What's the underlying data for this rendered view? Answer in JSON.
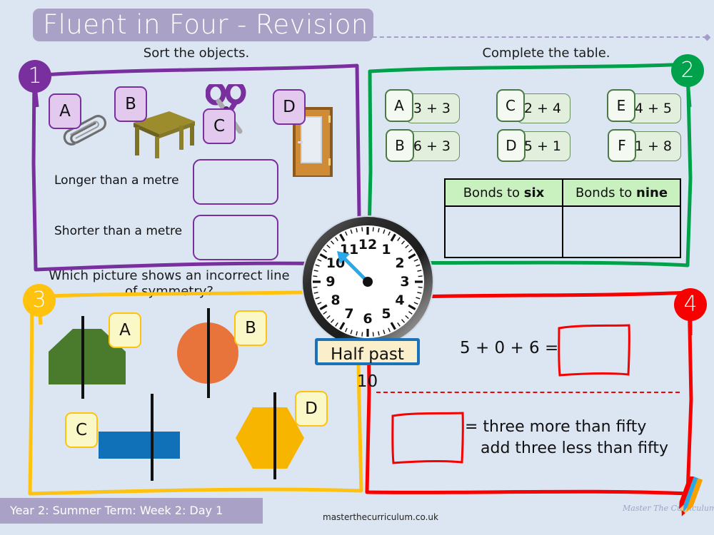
{
  "header": {
    "title": "Fluent in Four - Revision"
  },
  "sections": [
    {
      "number": "1",
      "color": "#7a2f9e",
      "prompt": "Sort the objects.",
      "objects": [
        {
          "label": "A",
          "icon": "paperclip-icon"
        },
        {
          "label": "B",
          "icon": "table-icon"
        },
        {
          "label": "C",
          "icon": "scissors-icon"
        },
        {
          "label": "D",
          "icon": "door-icon"
        }
      ],
      "rows": [
        {
          "label": "Longer than a metre",
          "answer": ""
        },
        {
          "label": "Shorter than a metre",
          "answer": ""
        }
      ]
    },
    {
      "number": "2",
      "color": "#00a14b",
      "prompt": "Complete the table.",
      "sums": [
        {
          "label": "A",
          "expr": "3 + 3"
        },
        {
          "label": "B",
          "expr": "6 + 3"
        },
        {
          "label": "C",
          "expr": "2 + 4"
        },
        {
          "label": "D",
          "expr": "5 + 1"
        },
        {
          "label": "E",
          "expr": "4 + 5"
        },
        {
          "label": "F",
          "expr": "1 + 8"
        }
      ],
      "table": {
        "headers": [
          "Bonds to six",
          "Bonds to nine"
        ],
        "header_plain": [
          "Bonds to ",
          "Bonds to "
        ],
        "header_bold": [
          "six",
          "nine"
        ],
        "rows": [
          [
            "",
            ""
          ]
        ]
      }
    },
    {
      "number": "3",
      "color": "#ffc20e",
      "prompt": "Which picture shows an incorrect line of symmetry?",
      "shapes": [
        {
          "label": "A",
          "shape": "pentagon-house-icon",
          "color": "#4a7a2b"
        },
        {
          "label": "B",
          "shape": "circle-icon",
          "color": "#e8743b"
        },
        {
          "label": "C",
          "shape": "rectangle-icon",
          "color": "#1071b8"
        },
        {
          "label": "D",
          "shape": "hexagon-icon",
          "color": "#f7b500"
        }
      ]
    },
    {
      "number": "4",
      "color": "#f60000",
      "equation": "5 + 0 + 6 =",
      "statement_line1": "= three more than fifty",
      "statement_line2": "add three less than fifty",
      "answer_top": "",
      "answer_bottom": ""
    }
  ],
  "clock": {
    "time_label": "Half past 10",
    "numbers": [
      "12",
      "1",
      "2",
      "3",
      "4",
      "5",
      "6",
      "7",
      "8",
      "9",
      "10",
      "11"
    ],
    "hand_target": "between 10 and 11"
  },
  "footer": {
    "lesson": "Year 2: Summer Term: Week 2: Day 1",
    "website": "masterthecurriculum.co.uk",
    "brand": "Master The Curriculum"
  }
}
